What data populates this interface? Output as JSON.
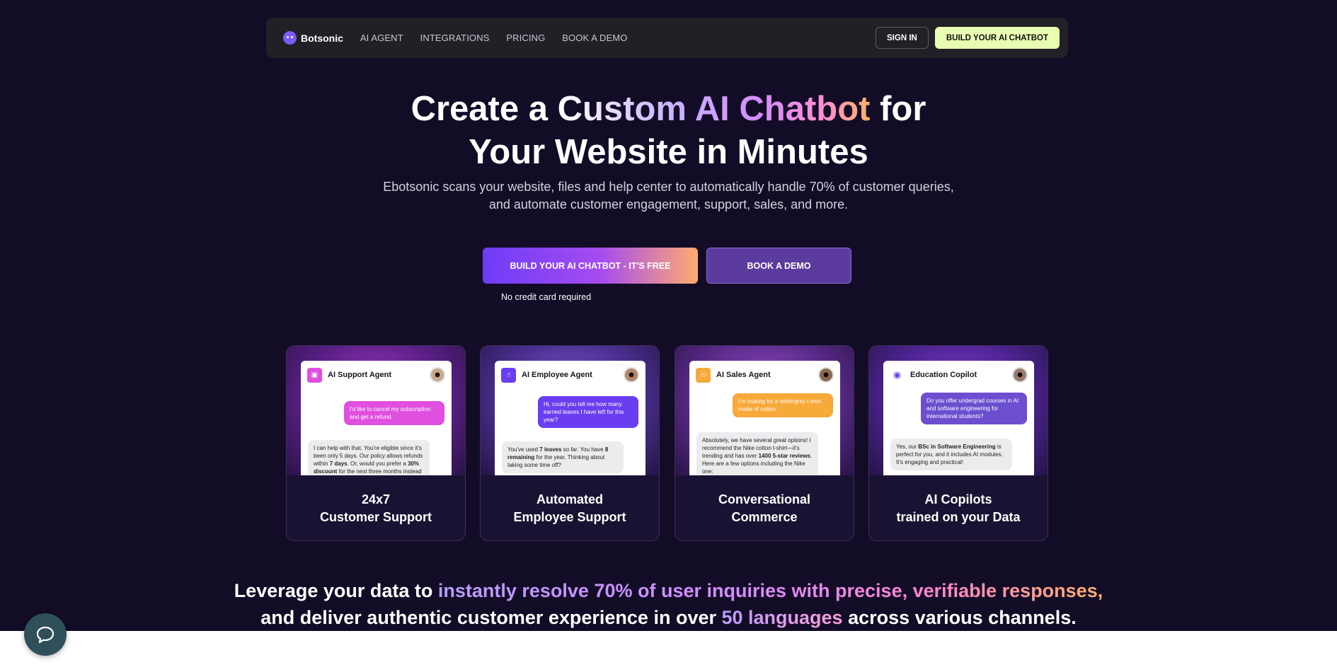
{
  "nav": {
    "brand": "Botsonic",
    "links": [
      "AI AGENT",
      "INTEGRATIONS",
      "PRICING",
      "BOOK A DEMO"
    ],
    "sign_in": "SIGN IN",
    "build": "BUILD YOUR AI CHATBOT"
  },
  "hero": {
    "title_1a": "Create a ",
    "title_1b": "Custom AI Chatbot",
    "title_1c": " for",
    "title_2": "Your Website in Minutes",
    "sub_1": "Ebotsonic scans your website, files and help center to automatically handle 70% of customer queries,",
    "sub_2": "and automate customer engagement, support, sales, and more.",
    "cta_primary": "BUILD YOUR AI CHATBOT - IT'S FREE",
    "cta_secondary": "BOOK A DEMO",
    "note": "No credit card required"
  },
  "cards": [
    {
      "chat_title": "AI Support Agent",
      "badge_icon": "clipboard-icon",
      "badge_color": "#e04fe0",
      "user_color": "#e04fe0",
      "user_msg": "I'd like to cancel my subscription and get a refund.",
      "bot_msg_1": "I can help with that. You're eligible since it's been only 5 days. Our policy allows refunds within ",
      "bot_bold_1": "7 days",
      "bot_msg_2": ". Or, would you prefer a ",
      "bot_bold_2": "30% discount",
      "bot_msg_3": " for the next three months instead of cancelling?",
      "label_1": "24x7",
      "label_2": "Customer Support"
    },
    {
      "chat_title": "AI Employee Agent",
      "badge_icon": "hand-icon",
      "badge_color": "#6a3ef0",
      "user_color": "#6a3ef0",
      "user_msg": "Hi, could you tell me how many earned leaves I have left for this year?",
      "bot_msg_1": "You've used ",
      "bot_bold_1": "7 leaves",
      "bot_msg_2": " so far. You have ",
      "bot_bold_2": "8 remaining",
      "bot_msg_3": " for the year. Thinking about taking some time off?",
      "label_1": "Automated",
      "label_2": "Employee Support"
    },
    {
      "chat_title": "AI Sales Agent",
      "badge_icon": "cart-icon",
      "badge_color": "#f7a93a",
      "user_color": "#f7a93a",
      "user_msg": "I'm looking for a white/grey t-shirt made of cotton.",
      "bot_msg_1": "Absolutely, we have several great options! I recommend the Nike cotton t-shirt—it's trending and has over ",
      "bot_bold_1": "1400 5-star reviews",
      "bot_msg_2": ". Here are a few options including the Nike one:",
      "bot_bold_2": "",
      "bot_msg_3": "",
      "label_1": "Conversational",
      "label_2": "Commerce"
    },
    {
      "chat_title": "Education Copilot",
      "badge_icon": "robot-icon",
      "badge_color": "#ffffff",
      "user_color": "#6b4fcf",
      "user_msg": "Do you offer undergrad courses in AI and software engineering for international students?",
      "bot_msg_1": "Yes, our ",
      "bot_bold_1": "BSc in Software Engineering",
      "bot_msg_2": " is perfect for you, and it includes AI modules. It's engaging and practical!",
      "bot_bold_2": "",
      "bot_msg_3": "",
      "label_1": "AI Copilots",
      "label_2": "trained on your Data"
    }
  ],
  "bottom": {
    "p1": "Leverage your data to ",
    "p2": "instantly resolve 70% of user inquiries with precise, verifiable responses,",
    "p3": "and deliver authentic customer experience in over ",
    "p4": "50 languages",
    "p5": " across various channels."
  },
  "colors": {
    "page_bg": "#130c27",
    "cta_gradient_start": "#6d3cf7",
    "cta_gradient_end": "#ffab6e",
    "build_btn": "#e9fdb2"
  }
}
